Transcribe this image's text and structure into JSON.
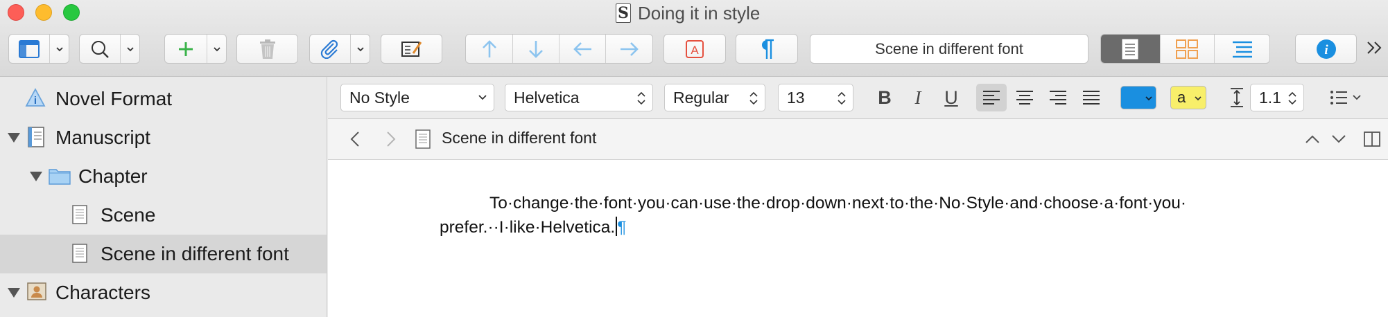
{
  "window": {
    "title": "Doing it in style"
  },
  "toolbar": {
    "title_field": "Scene in different font",
    "colors": {
      "green_plus": "#3ab34a",
      "blue_arrows": "#8cc4ef",
      "red_icon": "#e5503f",
      "blue_pilcrow": "#1a8fe0",
      "orange_grid": "#f0a050",
      "info_blue": "#1a8fe0"
    }
  },
  "binder": {
    "items": [
      {
        "label": "Novel Format"
      },
      {
        "label": "Manuscript"
      },
      {
        "label": "Chapter"
      },
      {
        "label": "Scene"
      },
      {
        "label": "Scene in different font"
      },
      {
        "label": "Characters"
      }
    ]
  },
  "format_bar": {
    "style": "No Style",
    "font": "Helvetica",
    "weight": "Regular",
    "size": "13",
    "bold": "B",
    "italic": "I",
    "underline": "U",
    "highlight_label": "a",
    "line_spacing": "1.1",
    "text_color": "#1a8fe0",
    "highlight_color": "#f8ef6a"
  },
  "header": {
    "doc_title": "Scene in different font"
  },
  "editor": {
    "line1": "To·change·the·font·you·can·use·the·drop·down·next·to·the·No·Style·and·choose·a·font·you·",
    "line2": "prefer.··I·like·Helvetica.",
    "pilcrow": "¶"
  }
}
